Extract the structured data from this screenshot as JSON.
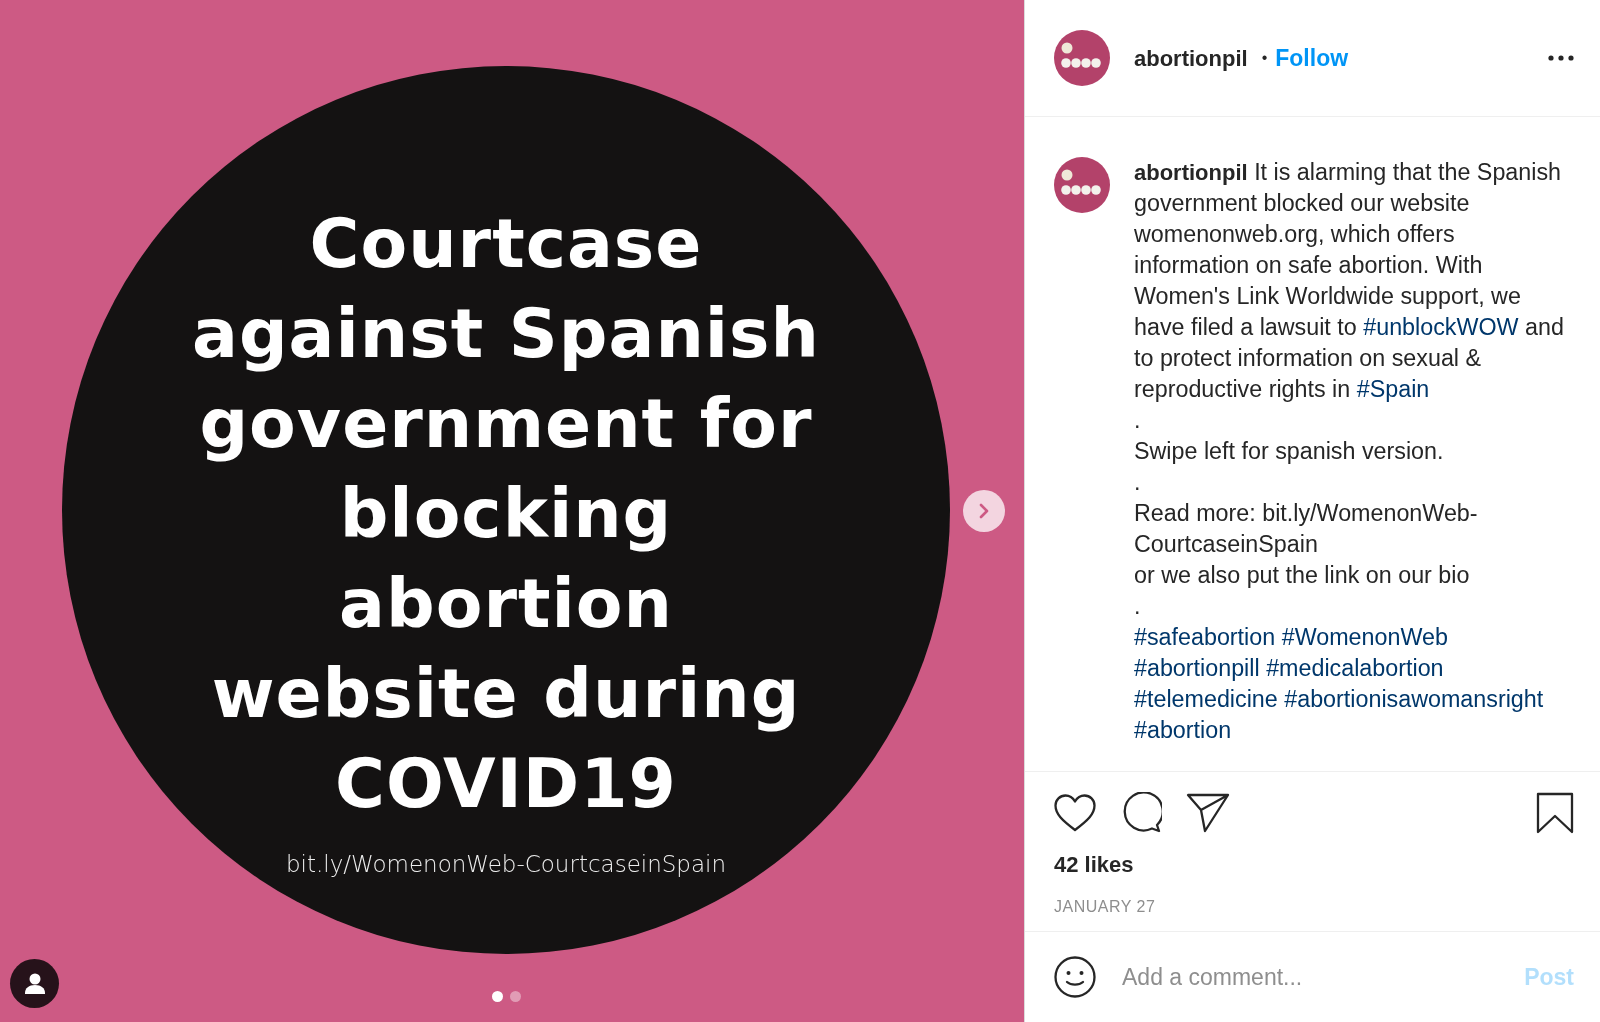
{
  "slide": {
    "title_lines": [
      "Courtcase",
      "against Spanish",
      "government for",
      "blocking",
      "abortion",
      "website during",
      "COVID19"
    ],
    "url": "bit.ly/WomenonWeb-CourtcaseinSpain",
    "dots": [
      {
        "selected": true
      },
      {
        "selected": false
      }
    ]
  },
  "header": {
    "username": "abortionpil",
    "separator": "•",
    "follow": "Follow"
  },
  "caption": {
    "username": "abortionpil",
    "paragraphs": [
      [
        {
          "kind": "text",
          "text": " It is alarming that the Spanish government blocked our website womenonweb.org, which offers information on safe abortion. With Women's Link Worldwide support, we have filed a lawsuit to "
        },
        {
          "kind": "hashtag",
          "text": "#unblockWOW"
        },
        {
          "kind": "text",
          "text": " and to protect information on sexual & reproductive rights in "
        },
        {
          "kind": "hashtag",
          "text": "#Spain"
        }
      ],
      [
        {
          "kind": "text",
          "text": "."
        }
      ],
      [
        {
          "kind": "text",
          "text": "Swipe left for spanish version."
        }
      ],
      [
        {
          "kind": "text",
          "text": "."
        }
      ],
      [
        {
          "kind": "text",
          "text": "Read more: bit.ly/WomenonWeb-CourtcaseinSpain"
        }
      ],
      [
        {
          "kind": "text",
          "text": "or we also put the link on our bio"
        }
      ],
      [
        {
          "kind": "text",
          "text": "."
        }
      ],
      [
        {
          "kind": "hashtag",
          "text": "#safeabortion"
        },
        {
          "kind": "hashtag",
          "text": "#WomenonWeb"
        },
        {
          "kind": "hashtag",
          "text": "#abortionpill"
        },
        {
          "kind": "hashtag",
          "text": "#medicalabortion"
        },
        {
          "kind": "hashtag",
          "text": "#telemedicine"
        },
        {
          "kind": "hashtag",
          "text": "#abortionisawomansright"
        },
        {
          "kind": "hashtag",
          "text": "#abortion"
        }
      ]
    ]
  },
  "likes": "42 likes",
  "date": "JANUARY 27",
  "comment": {
    "placeholder": "Add a comment...",
    "post": "Post",
    "post_disabled": true
  }
}
